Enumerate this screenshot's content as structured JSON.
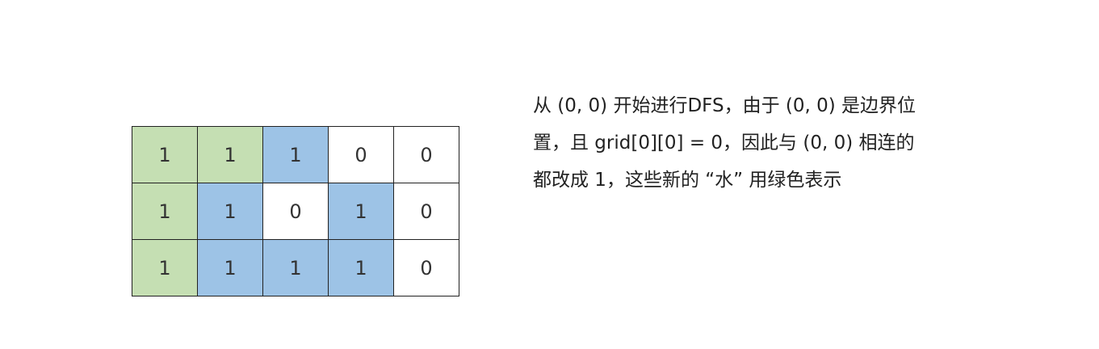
{
  "grid": {
    "rows": [
      [
        {
          "value": "1",
          "state": "green"
        },
        {
          "value": "1",
          "state": "green"
        },
        {
          "value": "1",
          "state": "blue"
        },
        {
          "value": "0",
          "state": "white"
        },
        {
          "value": "0",
          "state": "white"
        }
      ],
      [
        {
          "value": "1",
          "state": "green"
        },
        {
          "value": "1",
          "state": "blue"
        },
        {
          "value": "0",
          "state": "white"
        },
        {
          "value": "1",
          "state": "blue"
        },
        {
          "value": "0",
          "state": "white"
        }
      ],
      [
        {
          "value": "1",
          "state": "green"
        },
        {
          "value": "1",
          "state": "blue"
        },
        {
          "value": "1",
          "state": "blue"
        },
        {
          "value": "1",
          "state": "blue"
        },
        {
          "value": "0",
          "state": "white"
        }
      ]
    ]
  },
  "colors": {
    "green": "#c5dfb3",
    "blue": "#9dc3e6",
    "white": "#ffffff"
  },
  "caption": {
    "lines": [
      "从 (0, 0) 开始进行DFS，由于 (0, 0) 是边界位",
      "置，且 grid[0][0] = 0，因此与 (0, 0) 相连的",
      "都改成 1，这些新的 “水” 用绿色表示"
    ]
  }
}
